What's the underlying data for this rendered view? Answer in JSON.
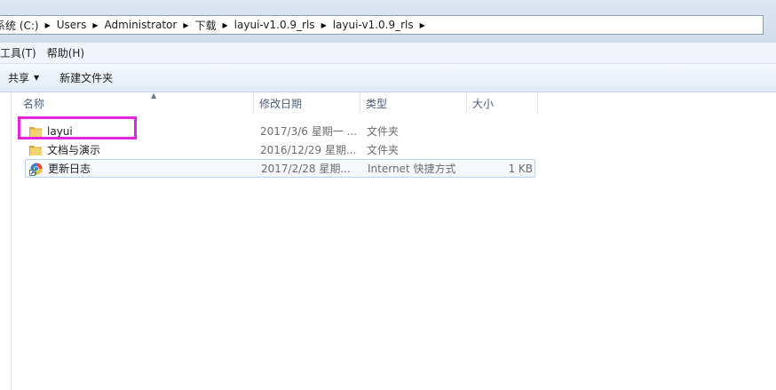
{
  "address_bar": {
    "crumbs": [
      "系统 (C:)",
      "Users",
      "Administrator",
      "下载",
      "layui-v1.0.9_rls",
      "layui-v1.0.9_rls"
    ]
  },
  "menu": {
    "tools": "工具(T)",
    "help": "帮助(H)"
  },
  "toolbar": {
    "share": "共享",
    "new_folder": "新建文件夹"
  },
  "columns": {
    "name": "名称",
    "date": "修改日期",
    "type": "类型",
    "size": "大小"
  },
  "files": [
    {
      "name": "layui",
      "date": "2017/3/6 星期一 ...",
      "type": "文件夹",
      "size": "",
      "icon": "folder-icon"
    },
    {
      "name": "文档与演示",
      "date": "2016/12/29 星期...",
      "type": "文件夹",
      "size": "",
      "icon": "folder-icon"
    },
    {
      "name": "更新日志",
      "date": "2017/2/28 星期...",
      "type": "Internet 快捷方式",
      "size": "1 KB",
      "icon": "internet-shortcut-icon"
    }
  ],
  "colors": {
    "highlight": "#e324e0",
    "hover_border": "#b7d3ef",
    "folder": "#e8c35a"
  }
}
